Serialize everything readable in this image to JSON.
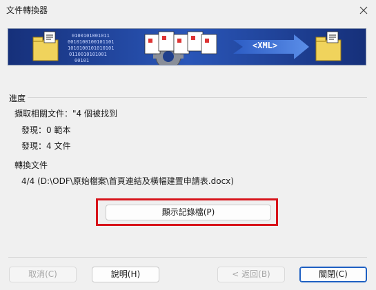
{
  "window": {
    "title": "文件轉換器"
  },
  "banner": {
    "xml_label": "<XML>",
    "binary_text": "0100101001011\n0010100100101101\n1010100101010101\n0110010101001\n00101"
  },
  "progress": {
    "section_title": "進度",
    "fetch_label": "擷取相關文件：\"4 個被找到",
    "found_templates": "發現：0 範本",
    "found_docs": "發現：4 文件"
  },
  "convert": {
    "section_title": "轉換文件",
    "current_file": "4/4  (D:\\ODF\\原始檔案\\首頁連結及橫幅建置申請表.docx)"
  },
  "buttons": {
    "show_log": "顯示記錄檔(P)",
    "cancel": "取消(C)",
    "help": "說明(H)",
    "back": "< 返回(B)",
    "close": "關閉(C)"
  },
  "colors": {
    "banner_bg": "#1f3f8c",
    "highlight": "#d7131a",
    "primary_border": "#1d5fc2"
  }
}
